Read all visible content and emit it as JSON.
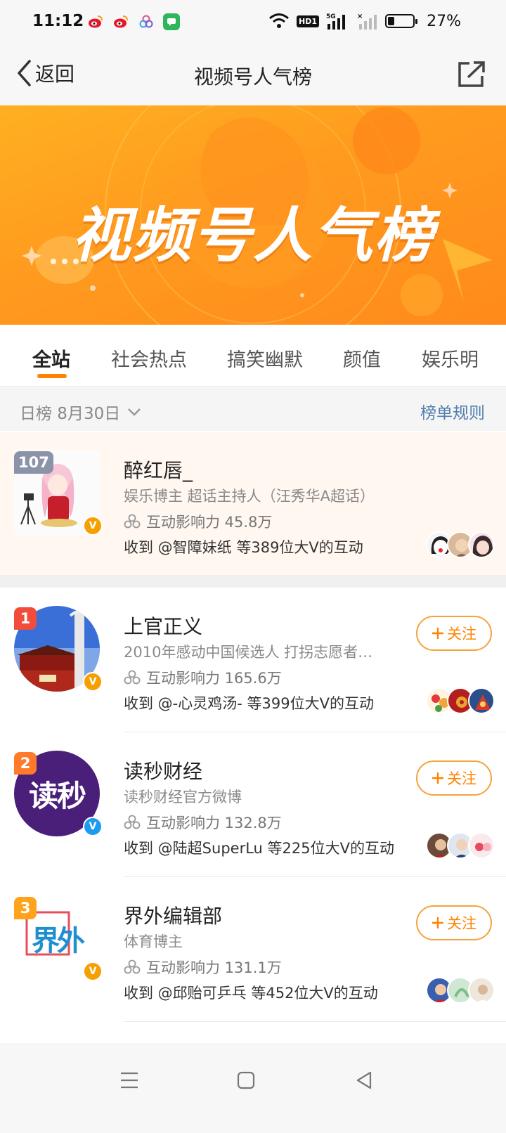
{
  "status_bar": {
    "time": "11:12",
    "battery_percent": "27%",
    "battery_level": 0.27,
    "network": "5G",
    "hd_label": "HD1"
  },
  "nav": {
    "back_label": "返回",
    "title": "视频号人气榜"
  },
  "banner": {
    "title": "视频号人气榜"
  },
  "tabs": [
    {
      "label": "全站",
      "active": true
    },
    {
      "label": "社会热点",
      "active": false
    },
    {
      "label": "搞笑幽默",
      "active": false
    },
    {
      "label": "颜值",
      "active": false
    },
    {
      "label": "娱乐明",
      "active": false
    }
  ],
  "date_bar": {
    "date_label": "日榜 8月30日",
    "rules_label": "榜单规则"
  },
  "my_entry": {
    "rank": "107",
    "name": "醉红唇_",
    "desc": "娱乐博主 超话主持人（汪秀华A超话）",
    "stat": "互动影响力 45.8万",
    "received": "收到 @智障妹纸 等389位大V的互动"
  },
  "entries": [
    {
      "rank": "1",
      "name": "上官正义",
      "desc": "2010年感动中国候选人 打拐志愿者 …",
      "stat": "互动影响力 165.6万",
      "received": "收到 @-心灵鸡汤- 等399位大V的互动",
      "follow_label": "关注"
    },
    {
      "rank": "2",
      "name": "读秒财经",
      "desc": "读秒财经官方微博",
      "avatar_text": "读秒",
      "stat": "互动影响力 132.8万",
      "received": "收到 @陆超SuperLu 等225位大V的互动",
      "follow_label": "关注"
    },
    {
      "rank": "3",
      "name": "界外编辑部",
      "desc": "体育博主",
      "avatar_text": "界外",
      "stat": "互动影响力 131.1万",
      "received": "收到 @邱贻可乒乓 等452位大V的互动",
      "follow_label": "关注"
    }
  ],
  "colors": {
    "accent": "#ff8200",
    "link": "#507daf",
    "rank1": "#f24c3d",
    "rank2": "#ff7a2b",
    "rank3": "#ffa21c",
    "verified_orange": "#f5a000",
    "verified_blue": "#1d9bf0"
  }
}
